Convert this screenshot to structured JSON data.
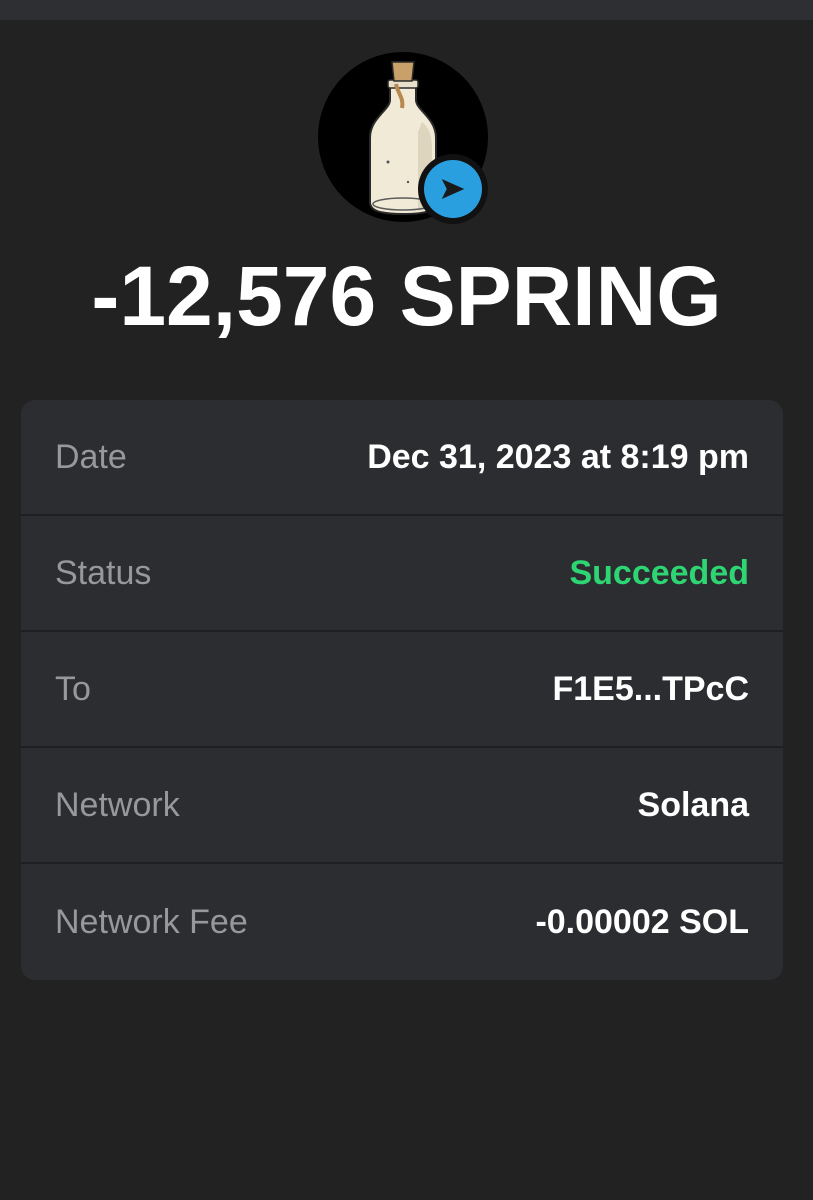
{
  "transaction": {
    "amount": "-12,576 SPRING",
    "token_icon": "bottle-token-avatar",
    "direction_icon": "send-arrow-icon"
  },
  "details": {
    "rows": [
      {
        "label": "Date",
        "value": "Dec 31, 2023 at 8:19 pm"
      },
      {
        "label": "Status",
        "value": "Succeeded"
      },
      {
        "label": "To",
        "value": "F1E5...TPcC"
      },
      {
        "label": "Network",
        "value": "Solana"
      },
      {
        "label": "Network Fee",
        "value": "-0.00002 SOL"
      }
    ]
  },
  "colors": {
    "background": "#222222",
    "card": "#2c2d31",
    "success": "#2ed573",
    "send_badge": "#2a9fe0"
  }
}
